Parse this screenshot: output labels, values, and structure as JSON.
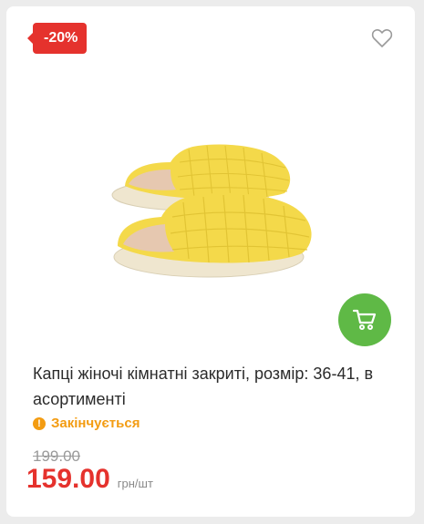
{
  "badge": {
    "discount": "-20%"
  },
  "icons": {
    "wishlist": "heart-outline-icon",
    "cart": "shopping-cart-icon",
    "stock": "exclamation-icon"
  },
  "product": {
    "title": "Капці жіночі кімнатні закриті, розмір: 36-41, в асортименті",
    "stock_status": "Закінчується",
    "old_price": "199.00",
    "price": "159.00",
    "unit": "грн/шт"
  },
  "colors": {
    "accent_red": "#e5322d",
    "cart_green": "#5fb946",
    "warning_orange": "#f39c12",
    "slipper_yellow": "#f4d94a"
  }
}
